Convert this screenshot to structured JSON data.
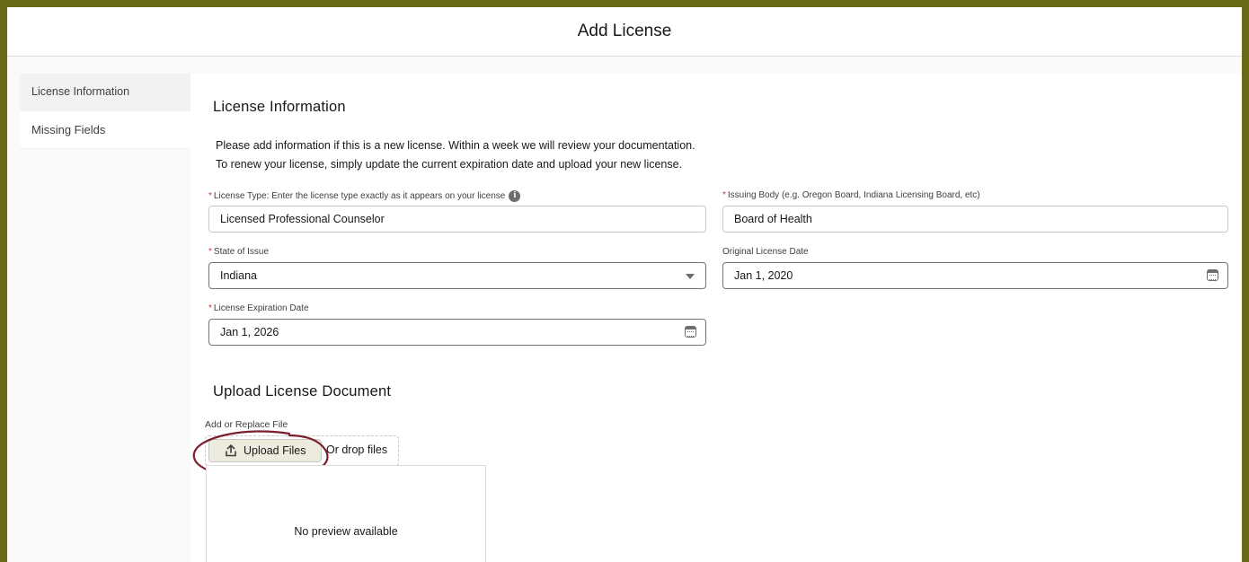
{
  "header": {
    "title": "Add License"
  },
  "nav": {
    "items": [
      {
        "label": "License Information",
        "active": true
      },
      {
        "label": "Missing Fields",
        "active": false
      }
    ]
  },
  "license_info": {
    "section_title": "License Information",
    "description_line1": "Please add information if this is a new license. Within a week we will review your documentation.",
    "description_line2": "To renew your license, simply update the current expiration date and upload your new license.",
    "license_type": {
      "label": "License Type: Enter the license type exactly as it appears on your license",
      "required": "*",
      "value": "Licensed Professional Counselor"
    },
    "issuing_body": {
      "label": "Issuing Body (e.g. Oregon Board, Indiana Licensing Board, etc)",
      "required": "*",
      "value": "Board of Health"
    },
    "state_of_issue": {
      "label": "State of Issue",
      "required": "*",
      "value": "Indiana"
    },
    "original_license_date": {
      "label": "Original License Date",
      "value": "Jan 1, 2020"
    },
    "license_expiration_date": {
      "label": "License Expiration Date",
      "required": "*",
      "value": "Jan 1, 2026"
    }
  },
  "upload": {
    "section_title": "Upload License Document",
    "field_label": "Add or Replace File",
    "button_label": "Upload Files",
    "drop_text": "Or drop files",
    "preview_text": "No preview available"
  },
  "colors": {
    "frame": "#6b6a17",
    "required": "#c23934",
    "highlight_circle": "#7a1f2b",
    "upload_button_bg": "#ecebdd"
  }
}
